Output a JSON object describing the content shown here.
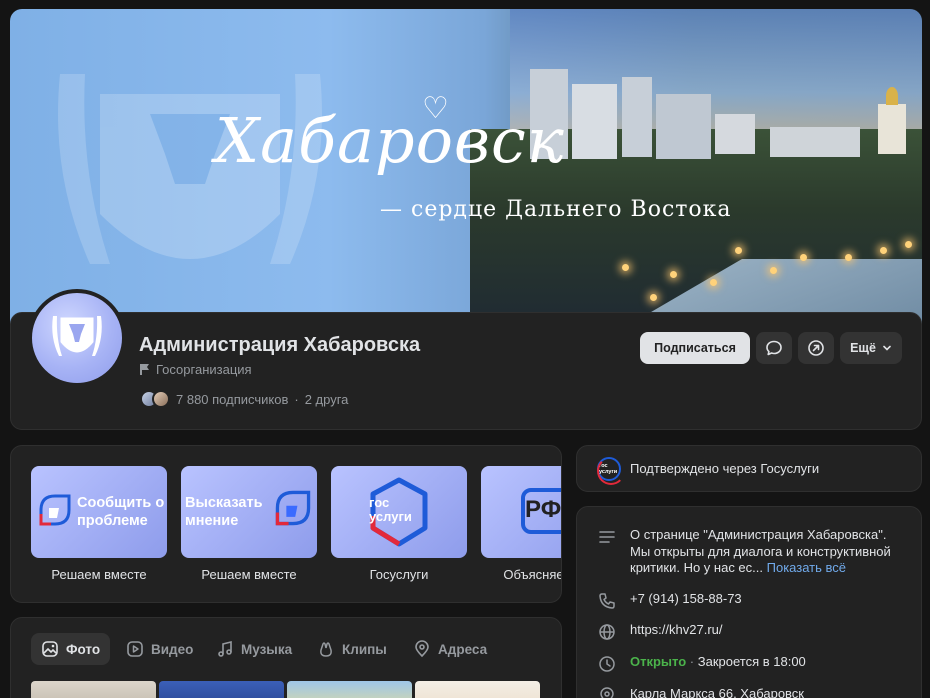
{
  "cover": {
    "title": "Хабаровск",
    "subtitle": "— сердце Дальнего Востока"
  },
  "header": {
    "name": "Администрация Хабаровска",
    "category": "Госорганизация",
    "subscribers": "7 880 подписчиков",
    "friends": "2 друга",
    "subscribe_label": "Подписаться",
    "more_label": "Ещё"
  },
  "widgets": [
    {
      "label": "Решаем вместе",
      "image_text": "Сообщить о проблеме"
    },
    {
      "label": "Решаем вместе",
      "image_text": "Высказать мнение"
    },
    {
      "label": "Госуслуги",
      "image_text": "гос услуги"
    },
    {
      "label": "Объясняем.РФ",
      "image_text": "РФ"
    }
  ],
  "media_tabs": [
    {
      "label": "Фото",
      "icon": "photo-icon",
      "active": true
    },
    {
      "label": "Видео",
      "icon": "video-icon",
      "active": false
    },
    {
      "label": "Музыка",
      "icon": "music-icon",
      "active": false
    },
    {
      "label": "Клипы",
      "icon": "clips-icon",
      "active": false
    },
    {
      "label": "Адреса",
      "icon": "location-icon",
      "active": false
    }
  ],
  "verified": {
    "text": "Подтверждено через Госуслуги",
    "logo_text": "гос услуги"
  },
  "about": {
    "description": "О странице \"Администрация Хабаровска\". Мы открыты для диалога и конструктивной критики. Но у нас ес...",
    "show_all": "Показать всё",
    "phone": "+7 (914) 158-88-73",
    "website": "https://khv27.ru/",
    "status_open": "Открыто",
    "status_closes": "Закроется в 18:00",
    "address": "Карла Маркса 66, Хабаровск"
  },
  "colors": {
    "background": "#141414",
    "card": "#222222",
    "accent_link": "#71aaeb",
    "open_green": "#4bb34b",
    "button_light": "#e1e3e6"
  }
}
